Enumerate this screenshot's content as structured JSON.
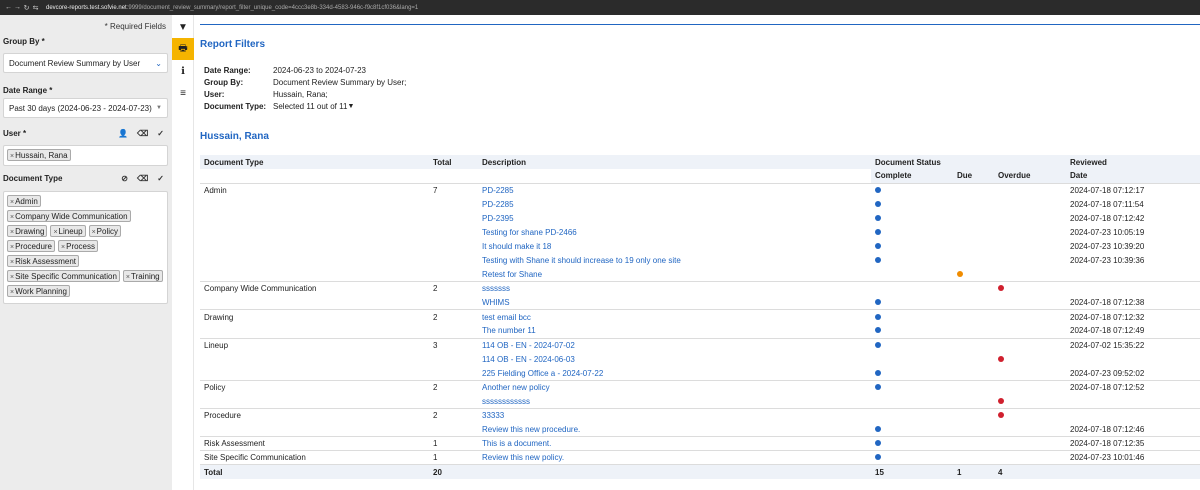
{
  "browser": {
    "url_host": "devcore-reports.test.sofvie.net",
    "url_rest": ":9999/document_review_summary/report_filter_unique_code=4ccc3e8b-334d-4583-946c-f9c8f1cf036&lang=1"
  },
  "sidebar": {
    "required_note": "* Required Fields",
    "group_by_label": "Group By *",
    "group_by_value": "Document Review Summary by User",
    "date_range_label": "Date Range *",
    "date_range_value": "Past 30 days (2024-06-23 - 2024-07-23)",
    "user_label": "User *",
    "users": [
      "Hussain, Rana"
    ],
    "doc_type_label": "Document Type",
    "doc_types": [
      "Admin",
      "Company Wide Communication",
      "Drawing",
      "Lineup",
      "Policy",
      "Procedure",
      "Process",
      "Risk Assessment",
      "Site Specific Communication",
      "Training",
      "Work Planning"
    ]
  },
  "toolbar": {
    "filter_icon": "▼",
    "print_icon": "🖶",
    "info_icon": "ℹ",
    "menu_icon": "≡"
  },
  "report": {
    "title": "Report Filters",
    "filters": [
      {
        "key": "Date Range:",
        "value": "2024-06-23 to 2024-07-23"
      },
      {
        "key": "Group By:",
        "value": "Document Review Summary by User;"
      },
      {
        "key": "User:",
        "value": "Hussain, Rana;"
      },
      {
        "key": "Document Type:",
        "value": "Selected 11 out of 11"
      }
    ],
    "user_heading": "Hussain, Rana",
    "headers": {
      "doc_type": "Document Type",
      "total": "Total",
      "description": "Description",
      "status": "Document Status",
      "reviewed": "Reviewed",
      "complete": "Complete",
      "due": "Due",
      "overdue": "Overdue",
      "date": "Date"
    },
    "rows": [
      {
        "type": "Admin",
        "total": "7",
        "desc": "PD-2285",
        "status": "complete",
        "date": "2024-07-18 07:12:17"
      },
      {
        "type": "",
        "total": "",
        "desc": "PD-2285",
        "status": "complete",
        "date": "2024-07-18 07:11:54"
      },
      {
        "type": "",
        "total": "",
        "desc": "PD-2395",
        "status": "complete",
        "date": "2024-07-18 07:12:42"
      },
      {
        "type": "",
        "total": "",
        "desc": "Testing for shane PD-2466",
        "status": "complete",
        "date": "2024-07-23 10:05:19"
      },
      {
        "type": "",
        "total": "",
        "desc": "It should make it 18",
        "status": "complete",
        "date": "2024-07-23 10:39:20"
      },
      {
        "type": "",
        "total": "",
        "desc": "Testing with Shane it should increase to 19 only one site",
        "status": "complete",
        "date": "2024-07-23 10:39:36"
      },
      {
        "type": "",
        "total": "",
        "desc": "Retest for Shane",
        "status": "due",
        "date": ""
      },
      {
        "type": "Company Wide Communication",
        "total": "2",
        "desc": "sssssss",
        "status": "overdue",
        "date": ""
      },
      {
        "type": "",
        "total": "",
        "desc": "WHIMS",
        "status": "complete",
        "date": "2024-07-18 07:12:38"
      },
      {
        "type": "Drawing",
        "total": "2",
        "desc": "test email bcc",
        "status": "complete",
        "date": "2024-07-18 07:12:32"
      },
      {
        "type": "",
        "total": "",
        "desc": "The number 11",
        "status": "complete",
        "date": "2024-07-18 07:12:49"
      },
      {
        "type": "Lineup",
        "total": "3",
        "desc": "114 OB - EN - 2024-07-02",
        "status": "complete",
        "date": "2024-07-02 15:35:22"
      },
      {
        "type": "",
        "total": "",
        "desc": "114 OB - EN - 2024-06-03",
        "status": "overdue",
        "date": ""
      },
      {
        "type": "",
        "total": "",
        "desc": "225 Fielding Office a - 2024-07-22",
        "status": "complete",
        "date": "2024-07-23 09:52:02"
      },
      {
        "type": "Policy",
        "total": "2",
        "desc": "Another new policy",
        "status": "complete",
        "date": "2024-07-18 07:12:52"
      },
      {
        "type": "",
        "total": "",
        "desc": "ssssssssssss",
        "status": "overdue",
        "date": ""
      },
      {
        "type": "Procedure",
        "total": "2",
        "desc": "33333",
        "status": "overdue",
        "date": ""
      },
      {
        "type": "",
        "total": "",
        "desc": "Review this new procedure.",
        "status": "complete",
        "date": "2024-07-18 07:12:46"
      },
      {
        "type": "Risk Assessment",
        "total": "1",
        "desc": "This is a document.",
        "status": "complete",
        "date": "2024-07-18 07:12:35"
      },
      {
        "type": "Site Specific Communication",
        "total": "1",
        "desc": "Review this new policy.",
        "status": "complete",
        "date": "2024-07-23 10:01:46"
      }
    ],
    "totals": {
      "label": "Total",
      "total": "20",
      "complete": "15",
      "due": "1",
      "overdue": "4"
    },
    "colors": {
      "complete": "#2166c2",
      "due": "#f08c00",
      "overdue": "#d0202e",
      "accent": "#2166c2",
      "print_active": "#f5b400"
    }
  }
}
